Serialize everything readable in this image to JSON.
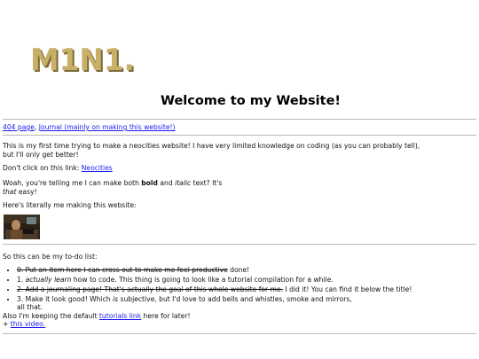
{
  "logo": {
    "text": "M1N1."
  },
  "title": "Welcome to my Website!",
  "nav": {
    "link_404": "404 page",
    "sep": ",",
    "link_journal": "Journal (mainly on making this website!)"
  },
  "intro": {
    "line1": "This is my first time trying to make a neocities website! I have very limited knowledge on coding (as you can probably tell),",
    "line2": "but I'll only get better!"
  },
  "dont_click": {
    "prefix": "Don't click on this link: ",
    "link": "Neocities"
  },
  "formatting": {
    "a": "Woah, you're telling me I can make both ",
    "bold": "bold",
    "b": " and ",
    "italic": "italic",
    "c": " text? It's",
    "that": "that",
    "d": " easy!"
  },
  "literally": "Here's literally me making this website:",
  "todo": {
    "intro": "So this can be my to-do list:",
    "items": [
      {
        "struck": "0. Put an item here I can cross out to make me feel productive",
        "rest": " done!"
      },
      {
        "num": "1. ",
        "em": "actually learn",
        "rest": " how to code. This thing is going to look like a tutorial compilation for a while."
      },
      {
        "struck": "2. Add a journaling page! That's actually the goal of this whole website for me.",
        "rest": " I did it! You can find it below the title!"
      },
      {
        "a": "3. Make it look good! Which ",
        "em": "is",
        "b": " subjective, but I'd love to add bells and whistles, smoke and mirrors,",
        "c": "all that."
      }
    ]
  },
  "footer": {
    "a": "Also I'm keeping the default ",
    "link_tutorials": "tutorials link",
    "b": " here for later!",
    "plus": "+ ",
    "link_video": "this video."
  },
  "colors": {
    "logo_fill": "#c8b068",
    "logo_shadow": "#7a6a38",
    "link": "#1a1aee",
    "rule": "#b8b8b8"
  }
}
